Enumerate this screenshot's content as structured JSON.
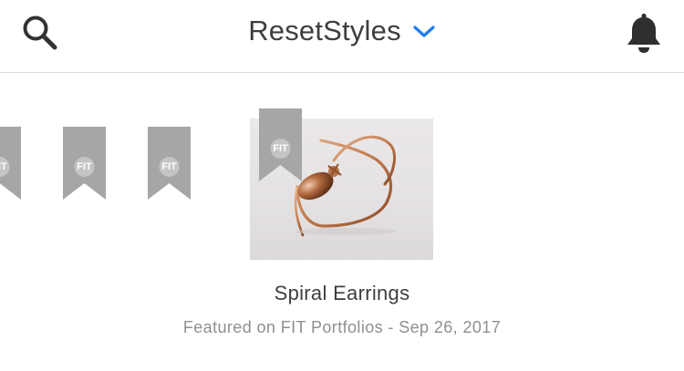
{
  "header": {
    "title": "ResetStyles",
    "icons": {
      "search": "search-icon",
      "dropdown": "chevron-down-icon",
      "notifications": "bell-icon"
    },
    "accent": "#1f7cf0"
  },
  "badges": {
    "label": "FIT",
    "color": "#a6a6a6"
  },
  "card": {
    "title": "Spiral Earrings",
    "meta": "Featured on FIT Portfolios - Sep 26, 2017",
    "image_alt": "spiral-earring-photo"
  }
}
